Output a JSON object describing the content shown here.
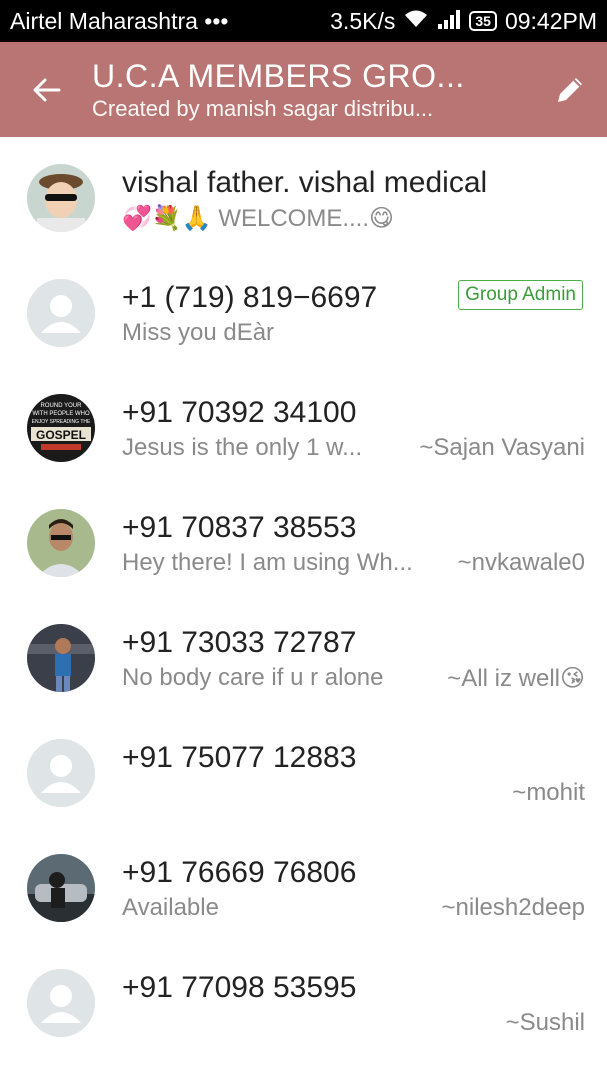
{
  "status_bar": {
    "carrier": "Airtel Maharashtra •••",
    "speed": "3.5K/s",
    "battery": "35",
    "time": "09:42PM"
  },
  "toolbar": {
    "title": "U.C.A MEMBERS GRO...",
    "subtitle": "Created by manish sagar distribu..."
  },
  "members": [
    {
      "name": "vishal father. vishal medical",
      "status": "💞💐🙏  WELCOME....😋",
      "alias": "",
      "badge": "",
      "avatar": "photo-child"
    },
    {
      "name": "+1 (719) 819−6697",
      "status": "Miss you dEàr",
      "alias": "",
      "badge": "Group Admin",
      "avatar": "default"
    },
    {
      "name": "+91 70392 34100",
      "status": "Jesus is the only 1 w...",
      "alias": "~Sajan Vasyani",
      "badge": "",
      "avatar": "gospel"
    },
    {
      "name": "+91 70837 38553",
      "status": "Hey there! I am using Wh...",
      "alias": "~nvkawale0",
      "badge": "",
      "avatar": "photo-man"
    },
    {
      "name": "+91 73033 72787",
      "status": "No body care if u r alone",
      "alias": "~All iz well😘",
      "badge": "",
      "avatar": "photo-person"
    },
    {
      "name": "+91 75077 12883",
      "status": "",
      "alias": "~mohit",
      "badge": "",
      "avatar": "default"
    },
    {
      "name": "+91 76669 76806",
      "status": "Available",
      "alias": "~nilesh2deep",
      "badge": "",
      "avatar": "photo-car"
    },
    {
      "name": "+91 77098 53595",
      "status": "",
      "alias": "~Sushil",
      "badge": "",
      "avatar": "default"
    }
  ],
  "gospel_avatar_text": {
    "line1": "ROUND YOUR",
    "line2": "WITH PEOPLE WHO",
    "line3": "ENJOY SPREADING THE",
    "line4": "GOSPEL"
  }
}
